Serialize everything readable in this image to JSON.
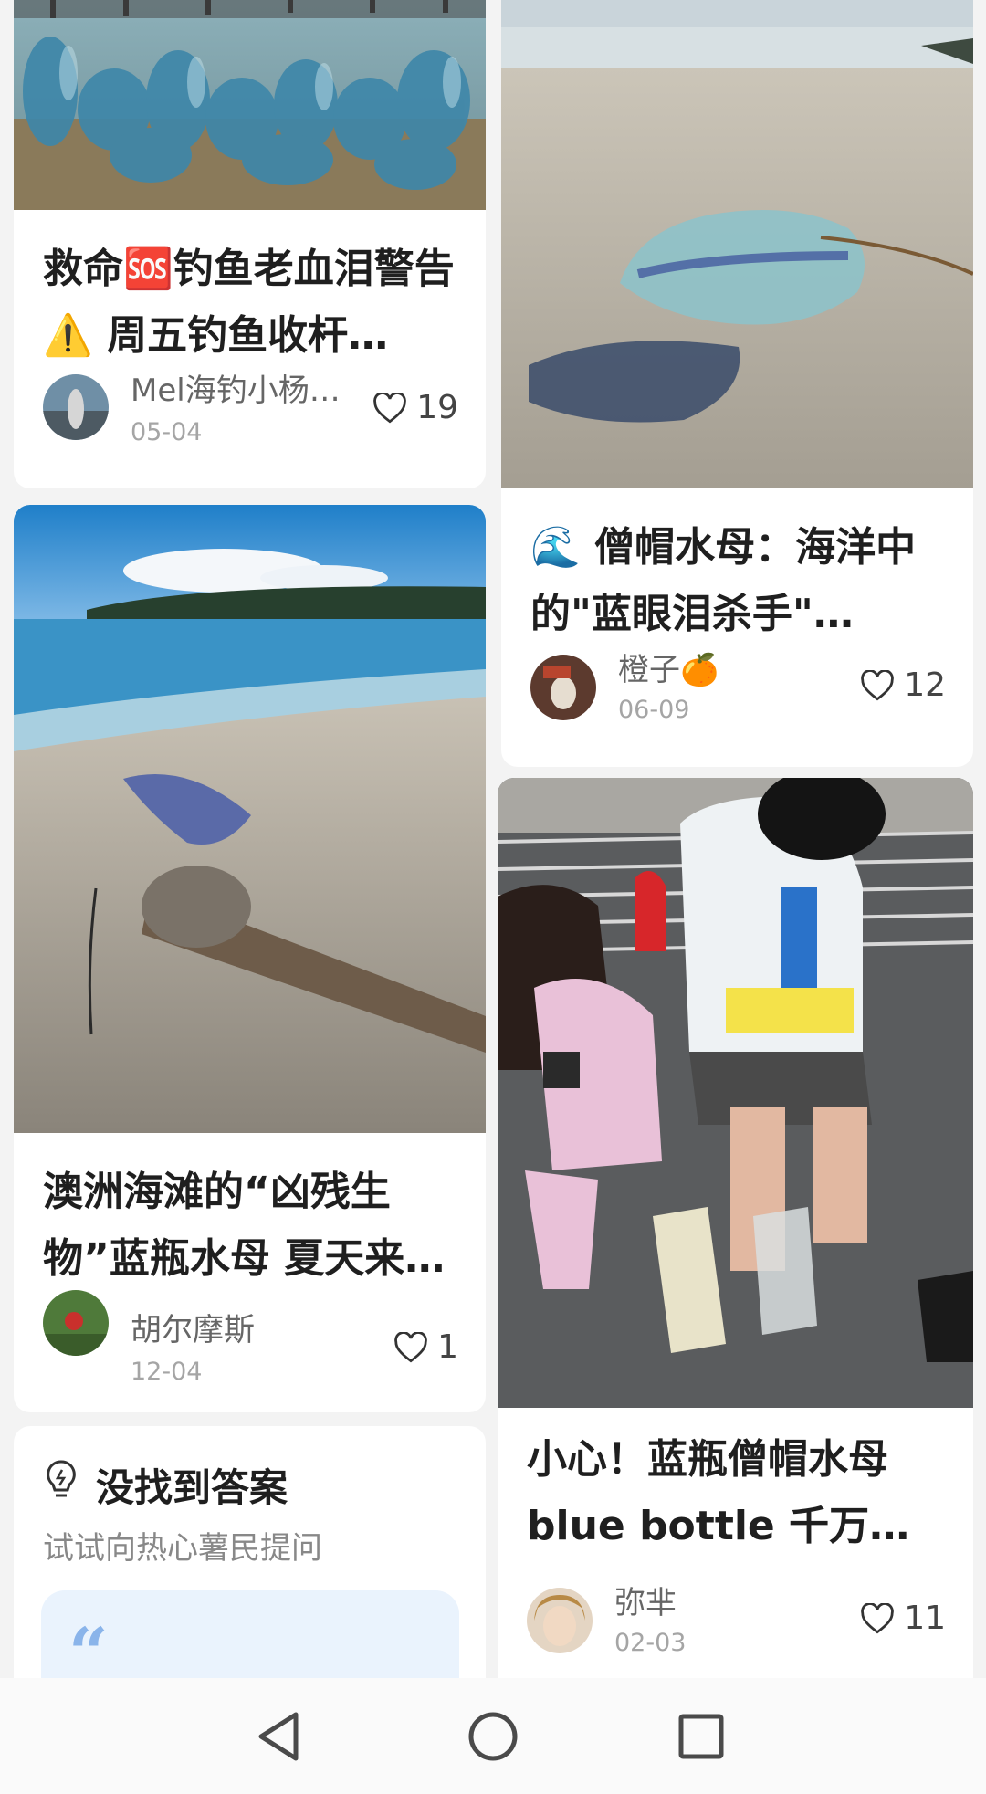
{
  "cards": [
    {
      "title": "救命🆘钓鱼老血泪警告⚠️ 周五钓鱼收杆…",
      "author": "Mel海钓小杨…",
      "date": "05-04",
      "likes": "19"
    },
    {
      "title": "🌊 僧帽水母：海洋中的\"蓝眼泪杀手\" ——…",
      "author": "橙子🍊",
      "date": "06-09",
      "likes": "12"
    },
    {
      "title": "澳洲海滩的“凶残生物”蓝瓶水母 夏天来…",
      "author": "胡尔摩斯",
      "date": "12-04",
      "likes": "1"
    },
    {
      "title": "小心！蓝瓶僧帽水母blue bottle 千万小…",
      "author": "弥芈",
      "date": "02-03",
      "likes": "11"
    }
  ],
  "ask": {
    "title": "没找到答案",
    "subtitle": "试试向热心薯民提问",
    "quote_mark": "“"
  },
  "colors": {
    "background": "#f3f3f3",
    "card": "#ffffff",
    "quote_box": "#eaf3fd",
    "quote_mark": "#8ab4ea"
  },
  "icons": [
    "heart-icon",
    "lightbulb-icon",
    "back-icon",
    "home-icon",
    "recents-icon"
  ]
}
